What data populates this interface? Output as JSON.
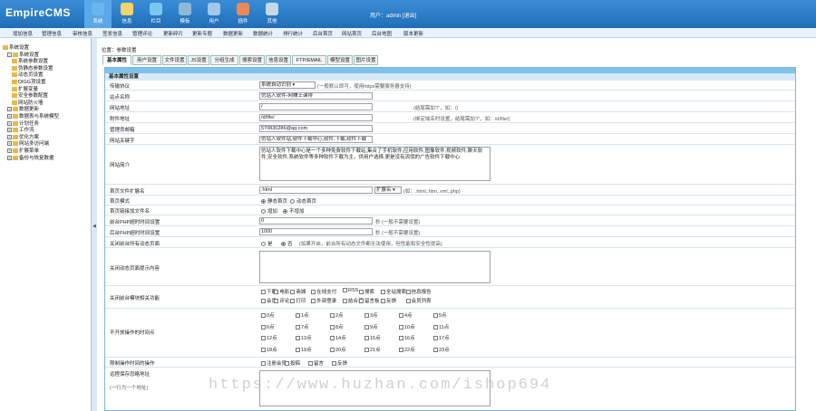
{
  "brand": {
    "logo": "EmpireCMS"
  },
  "top_nav": [
    {
      "label": "系统",
      "icon": "system-icon",
      "color": "#67b6ef"
    },
    {
      "label": "信息",
      "icon": "info-icon",
      "color": "#f3d36b"
    },
    {
      "label": "栏目",
      "icon": "column-icon",
      "color": "#7cc7f2"
    },
    {
      "label": "模板",
      "icon": "template-icon",
      "color": "#8fb8d8"
    },
    {
      "label": "用户",
      "icon": "user-icon",
      "color": "#a3c7ea"
    },
    {
      "label": "插件",
      "icon": "plugin-icon",
      "color": "#e88a5a"
    },
    {
      "label": "其他",
      "icon": "other-icon",
      "color": "#c7d8e8"
    }
  ],
  "user_info": "用户：admin [退出]",
  "menu_links": [
    "增加信息",
    "管理信息",
    "审核信息",
    "签发信息",
    "管理评论",
    "更新碎片",
    "更新专题",
    "数据更新",
    "数据统计",
    "排行统计",
    "后台首页",
    "网站首页",
    "后台地图",
    "版本更新"
  ],
  "sidebar": [
    {
      "label": "系统设置",
      "level": 0
    },
    {
      "label": "系统设置",
      "level": 1,
      "pm": "-"
    },
    {
      "label": "系统参数设置",
      "level": 2
    },
    {
      "label": "伪静态参数设置",
      "level": 2
    },
    {
      "label": "动态页设置",
      "level": 2
    },
    {
      "label": "DIGG顶设置",
      "level": 2
    },
    {
      "label": "扩展变量",
      "level": 2
    },
    {
      "label": "安全参数配置",
      "level": 2
    },
    {
      "label": "网站防火墙",
      "level": 2
    },
    {
      "label": "数据更新",
      "level": 1,
      "pm": "+"
    },
    {
      "label": "数据表与系统模型",
      "level": 1,
      "pm": "+"
    },
    {
      "label": "计划任务",
      "level": 1,
      "pm": "+"
    },
    {
      "label": "工作流",
      "level": 1,
      "pm": "+"
    },
    {
      "label": "优化方案",
      "level": 1,
      "pm": "+"
    },
    {
      "label": "网站多访问端",
      "level": 1,
      "pm": "+"
    },
    {
      "label": "扩展菜单",
      "level": 1,
      "pm": "+"
    },
    {
      "label": "备份与恢复数据",
      "level": 1,
      "pm": "+"
    }
  ],
  "location": "位置：参数设置",
  "tabs": [
    "基本属性",
    "用户设置",
    "文件设置",
    "JS设置",
    "分组生成",
    "搜索设置",
    "信息设置",
    "FTP/EMAIL",
    "模型设置",
    "图片设置"
  ],
  "panel_title": "基本属性设置",
  "rows": {
    "protocol": {
      "label": "传输协议",
      "value": "系统自动识别",
      "note": "(一般默认即可，使用https需要服务器支持)"
    },
    "sitename": {
      "label": "站点名称",
      "value": "仿站人软件-网赚士课得"
    },
    "siteurl": {
      "label": "网站地址",
      "value": "/",
      "note": "(结尾需加\"/\"，如：/)"
    },
    "attachurl": {
      "label": "附件地址",
      "value": "/d/file/",
      "note": "(绑定域名时设置，结尾需加\"/\"，如：/d/file/)"
    },
    "email": {
      "label": "管理员邮箱",
      "value": "570830286@qq.com"
    },
    "keywords": {
      "label": "网站关键字",
      "value": "仿站人软件站,软件下载中心,软件,下载,软件下载"
    },
    "intro": {
      "label": "网站简介",
      "value": "仿站人软件下载中心是一个多种免费软件下载站,集合了手机软件,应用软件,图像软件,视频软件,聊天软件,安全软件,系统软件等多种软件下载为主，供用户选择,更是没有流氓的广告软件下载中心."
    },
    "indexext": {
      "label": "首页文件扩展名",
      "value": ".html",
      "select": "扩展名",
      "note": "(如：.html,.htm,.xml,.php)"
    },
    "indexmode": {
      "label": "首页模式",
      "opt1": "静态首页",
      "opt2": "动态首页"
    },
    "indexlink": {
      "label": "首页链接加文件名",
      "opt1": "增加",
      "opt2": "不增加"
    },
    "front_timeout": {
      "label": "前台PHP超时时间设置",
      "value": "0",
      "note": "秒 (一般不需要设置)"
    },
    "back_timeout": {
      "label": "后台PHP超时时间设置",
      "value": "1000",
      "note": "秒 (一般不需要设置)"
    },
    "close_dynamic": {
      "label": "关闭前台所有动态页面",
      "opt1": "是",
      "opt2": "否",
      "note": "(如果开启，前台所有动态文件都无法使用，但性能和安全性提高)"
    },
    "close_tip": {
      "label": "关闭动态页面提示内容"
    },
    "close_modules": {
      "label": "关闭前台模块相关功能",
      "items": [
        "下载",
        "电影",
        "商城",
        "在线支付",
        "RSS",
        "搜索",
        "全站搜索",
        "信息报告",
        "会员",
        "评论",
        "打印",
        "外部登录",
        "结合项",
        "留言板",
        "反馈",
        "会员列表"
      ]
    },
    "no_hours": {
      "label": "不开放操作的时间点",
      "items": [
        "0点",
        "1点",
        "2点",
        "3点",
        "4点",
        "5点",
        "6点",
        "7点",
        "8点",
        "9点",
        "10点",
        "11点",
        "12点",
        "13点",
        "14点",
        "15点",
        "16点",
        "17点",
        "18点",
        "19点",
        "20点",
        "21点",
        "22点",
        "23点"
      ]
    },
    "limit_action": {
      "label": "限制操作时间的操作",
      "items": [
        "注册会员",
        "投稿",
        "留言",
        "反馈"
      ]
    },
    "remote_save": {
      "label": "远程保存忽略地址",
      "hint": "(一行为一个地址)"
    }
  },
  "watermark": "https://www.huzhan.com/ishop694"
}
